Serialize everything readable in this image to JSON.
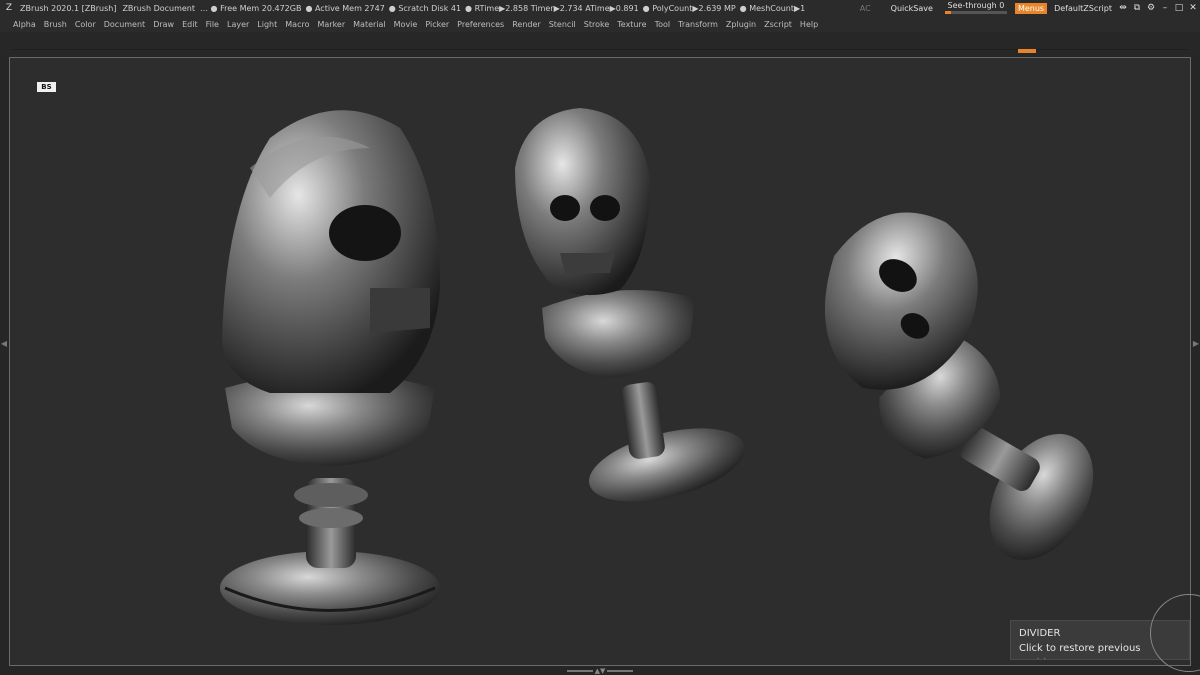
{
  "titlebar": {
    "app_title": "ZBrush 2020.1 [ZBrush]",
    "document": "ZBrush Document",
    "stats": [
      "… ● Free Mem 20.472GB",
      "● Active Mem 2747",
      "● Scratch Disk 41",
      "● RTime▶2.858 Timer▶2.734 ATime▶0.891",
      "● PolyCount▶2.639 MP",
      "● MeshCount▶1"
    ],
    "ac_label": "AC",
    "quicksave_label": "QuickSave",
    "seethrough_label": "See-through",
    "seethrough_value": "0",
    "seethrough_level": 0.0,
    "menus_label": "Menus",
    "script_label": "DefaultZScript",
    "icons": [
      "resize-arrows-icon",
      "dock-layout-icon",
      "gear-icon",
      "minimize-icon",
      "maximize-icon",
      "close-icon"
    ]
  },
  "menubar": {
    "items": [
      "Alpha",
      "Brush",
      "Color",
      "Document",
      "Draw",
      "Edit",
      "File",
      "Layer",
      "Light",
      "Macro",
      "Marker",
      "Material",
      "Movie",
      "Picker",
      "Preferences",
      "Render",
      "Stencil",
      "Stroke",
      "Texture",
      "Tool",
      "Transform",
      "Zplugin",
      "Zscript",
      "Help"
    ]
  },
  "canvas": {
    "badge": "BS"
  },
  "tooltip": {
    "title": "DIVIDER",
    "text": "Click to restore previous position."
  },
  "colors": {
    "accent": "#e8852a",
    "background": "#2d2d2d",
    "chrome": "#2b2b2b"
  }
}
